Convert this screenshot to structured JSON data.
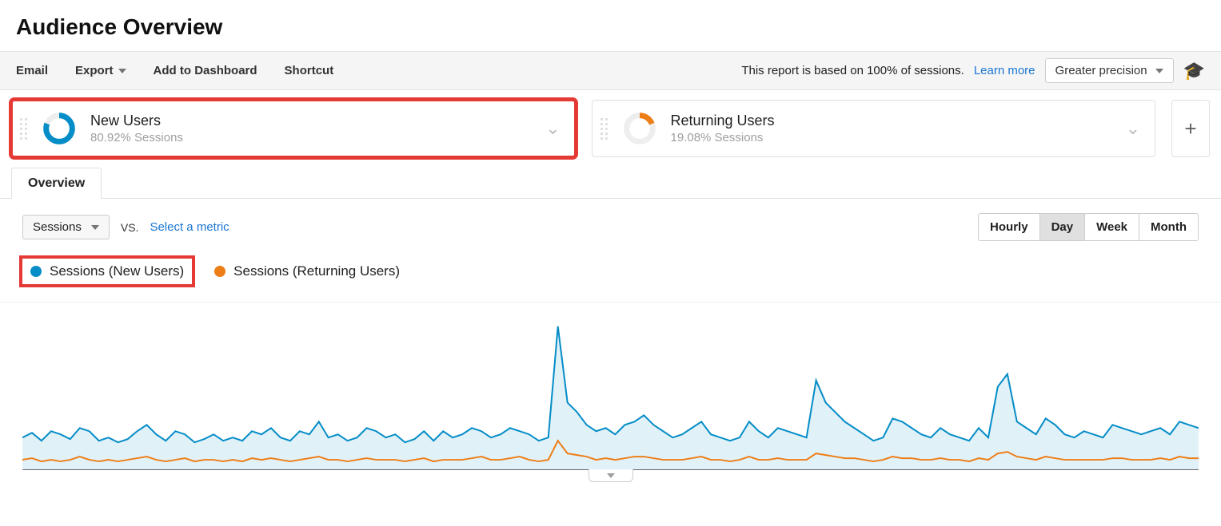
{
  "page": {
    "title": "Audience Overview"
  },
  "toolbar": {
    "email": "Email",
    "export": "Export",
    "addDashboard": "Add to Dashboard",
    "shortcut": "Shortcut",
    "reportNote": "This report is based on 100% of sessions.",
    "learnMore": "Learn more",
    "precision": "Greater precision"
  },
  "segments": [
    {
      "title": "New Users",
      "sub": "80.92% Sessions",
      "pct": 80.92,
      "color": "#058dc7",
      "highlighted": true
    },
    {
      "title": "Returning Users",
      "sub": "19.08% Sessions",
      "pct": 19.08,
      "color": "#ed7e17",
      "highlighted": false
    }
  ],
  "tabs": {
    "overview": "Overview"
  },
  "controls": {
    "metric": "Sessions",
    "vs": "VS.",
    "selectMetric": "Select a metric",
    "granularity": [
      "Hourly",
      "Day",
      "Week",
      "Month"
    ],
    "activeGranularity": "Day"
  },
  "legend": [
    {
      "label": "Sessions (New Users)",
      "colorClass": "blue",
      "highlighted": true
    },
    {
      "label": "Sessions (Returning Users)",
      "colorClass": "orange",
      "highlighted": false
    }
  ],
  "chart_data": {
    "type": "line",
    "xlabel": "",
    "ylabel": "Sessions",
    "ylim": [
      0,
      100
    ],
    "title": "",
    "series": [
      {
        "name": "Sessions (New Users)",
        "color": "#058dc7",
        "values": [
          20,
          23,
          18,
          24,
          22,
          19,
          26,
          24,
          18,
          20,
          17,
          19,
          24,
          28,
          22,
          18,
          24,
          22,
          17,
          19,
          22,
          18,
          20,
          18,
          24,
          22,
          26,
          20,
          18,
          24,
          22,
          30,
          20,
          22,
          18,
          20,
          26,
          24,
          20,
          22,
          17,
          19,
          24,
          18,
          24,
          20,
          22,
          26,
          24,
          20,
          22,
          26,
          24,
          22,
          18,
          20,
          90,
          42,
          36,
          28,
          24,
          26,
          22,
          28,
          30,
          34,
          28,
          24,
          20,
          22,
          26,
          30,
          22,
          20,
          18,
          20,
          30,
          24,
          20,
          26,
          24,
          22,
          20,
          56,
          42,
          36,
          30,
          26,
          22,
          18,
          20,
          32,
          30,
          26,
          22,
          20,
          26,
          22,
          20,
          18,
          26,
          20,
          52,
          60,
          30,
          26,
          22,
          32,
          28,
          22,
          20,
          24,
          22,
          20,
          28,
          26,
          24,
          22,
          24,
          26,
          22,
          30,
          28,
          26
        ]
      },
      {
        "name": "Sessions (Returning Users)",
        "color": "#ed7e17",
        "values": [
          6,
          7,
          5,
          6,
          5,
          6,
          8,
          6,
          5,
          6,
          5,
          6,
          7,
          8,
          6,
          5,
          6,
          7,
          5,
          6,
          6,
          5,
          6,
          5,
          7,
          6,
          7,
          6,
          5,
          6,
          7,
          8,
          6,
          6,
          5,
          6,
          7,
          6,
          6,
          6,
          5,
          6,
          7,
          5,
          6,
          6,
          6,
          7,
          8,
          6,
          6,
          7,
          8,
          6,
          5,
          6,
          18,
          10,
          9,
          8,
          6,
          7,
          6,
          7,
          8,
          8,
          7,
          6,
          6,
          6,
          7,
          8,
          6,
          6,
          5,
          6,
          8,
          6,
          6,
          7,
          6,
          6,
          6,
          10,
          9,
          8,
          7,
          7,
          6,
          5,
          6,
          8,
          7,
          7,
          6,
          6,
          7,
          6,
          6,
          5,
          7,
          6,
          10,
          11,
          8,
          7,
          6,
          8,
          7,
          6,
          6,
          6,
          6,
          6,
          7,
          7,
          6,
          6,
          6,
          7,
          6,
          8,
          7,
          7
        ]
      }
    ]
  }
}
